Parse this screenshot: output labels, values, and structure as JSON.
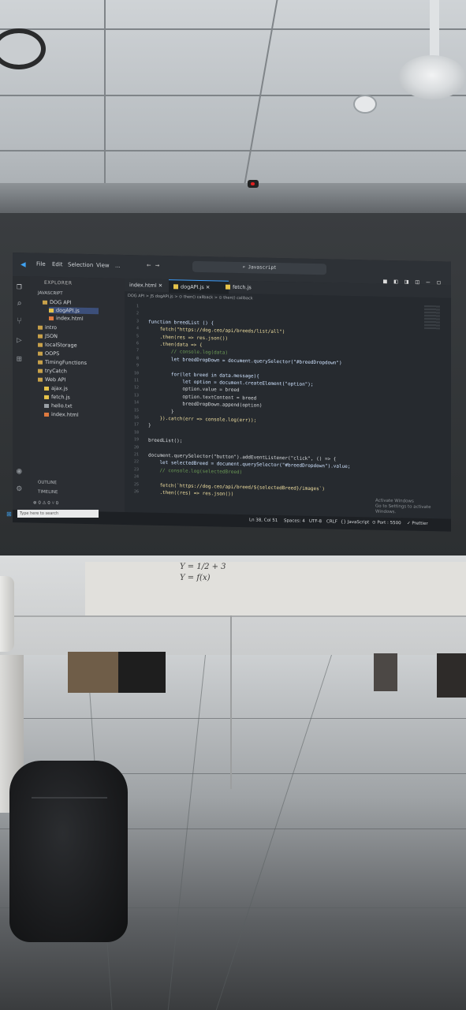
{
  "app": {
    "menu": [
      "File",
      "Edit",
      "Selection",
      "View",
      "..."
    ],
    "command_center": "Javascript",
    "window_controls": "■ ◧ ◨ ◫ — ◻ ✕"
  },
  "sidebar": {
    "header": "EXPLORER",
    "root": "JAVASCRIPT",
    "items": [
      {
        "label": "DOG API",
        "kind": "folder"
      },
      {
        "label": "dogAPI.js",
        "kind": "js"
      },
      {
        "label": "index.html",
        "kind": "html"
      },
      {
        "label": "intro",
        "kind": "folder"
      },
      {
        "label": "JSON",
        "kind": "folder"
      },
      {
        "label": "localStorage",
        "kind": "folder"
      },
      {
        "label": "OOPS",
        "kind": "folder"
      },
      {
        "label": "TimingFunctions",
        "kind": "folder"
      },
      {
        "label": "tryCatch",
        "kind": "folder"
      },
      {
        "label": "Web API",
        "kind": "folder"
      },
      {
        "label": "ajax.js",
        "kind": "js"
      },
      {
        "label": "fetch.js",
        "kind": "js"
      },
      {
        "label": "hello.txt",
        "kind": "txt"
      },
      {
        "label": "index.html",
        "kind": "html"
      }
    ],
    "footer_outline": "OUTLINE",
    "footer_timeline": "TIMELINE",
    "footer_status": "⊗ 0 ⚠ 0   ⑂ 0"
  },
  "tabs": [
    {
      "label": "index.html",
      "close": "✕"
    },
    {
      "label": "dogAPI.js",
      "close": "✕"
    },
    {
      "label": "fetch.js",
      "close": ""
    }
  ],
  "breadcrumbs": "DOG API > JS dogAPI.js > ⊙ then() callback > ⊙ then() callback",
  "code_lines": [
    {
      "n": "1",
      "text": ""
    },
    {
      "n": "2",
      "text": ""
    },
    {
      "n": "3",
      "text": "function breedList () {"
    },
    {
      "n": "4",
      "text": "    fetch(\"https://dog.ceo/api/breeds/list/all\")"
    },
    {
      "n": "5",
      "text": "    .then(res => res.json())"
    },
    {
      "n": "6",
      "text": "    .then(data => {"
    },
    {
      "n": "7",
      "text": "        // console.log(data)"
    },
    {
      "n": "8",
      "text": "        let breedDropDown = document.querySelector(\"#breedDropdown\")"
    },
    {
      "n": "9",
      "text": ""
    },
    {
      "n": "10",
      "text": "        for(let breed in data.message){"
    },
    {
      "n": "11",
      "text": "            let option = document.createElement(\"option\");"
    },
    {
      "n": "12",
      "text": "            option.value = breed"
    },
    {
      "n": "13",
      "text": "            option.textContent = breed"
    },
    {
      "n": "14",
      "text": "            breedDropDown.append(option)"
    },
    {
      "n": "15",
      "text": "        }"
    },
    {
      "n": "16",
      "text": "    }).catch(err => console.log(err));"
    },
    {
      "n": "17",
      "text": "}"
    },
    {
      "n": "18",
      "text": ""
    },
    {
      "n": "19",
      "text": "breedList();"
    },
    {
      "n": "20",
      "text": ""
    },
    {
      "n": "21",
      "text": "document.querySelector(\"button\").addEventListener(\"click\", () => {"
    },
    {
      "n": "22",
      "text": "    let selectedBreed = document.querySelector(\"#breedDropdown\").value;"
    },
    {
      "n": "23",
      "text": "    // console.log(selectedBreed)"
    },
    {
      "n": "24",
      "text": ""
    },
    {
      "n": "25",
      "text": "    fetch(`https://dog.ceo/api/breed/${selectedBreed}/images`)"
    },
    {
      "n": "26",
      "text": "    .then((res) => res.json())"
    }
  ],
  "status": {
    "position": "Ln 38, Col 51",
    "spaces": "Spaces: 4",
    "encoding": "UTF-8",
    "eol": "CRLF",
    "language": "{} JavaScript",
    "port": "⊙ Port : 5500",
    "prettier": "✓ Prettier"
  },
  "activate": {
    "line1": "Activate Windows",
    "line2": "Go to Settings to activate Windows."
  },
  "taskbar": {
    "search_placeholder": "Type here to search"
  },
  "whiteboard": {
    "line1": "Y = 1/2 + 3",
    "line2": "Y = f(x)"
  }
}
